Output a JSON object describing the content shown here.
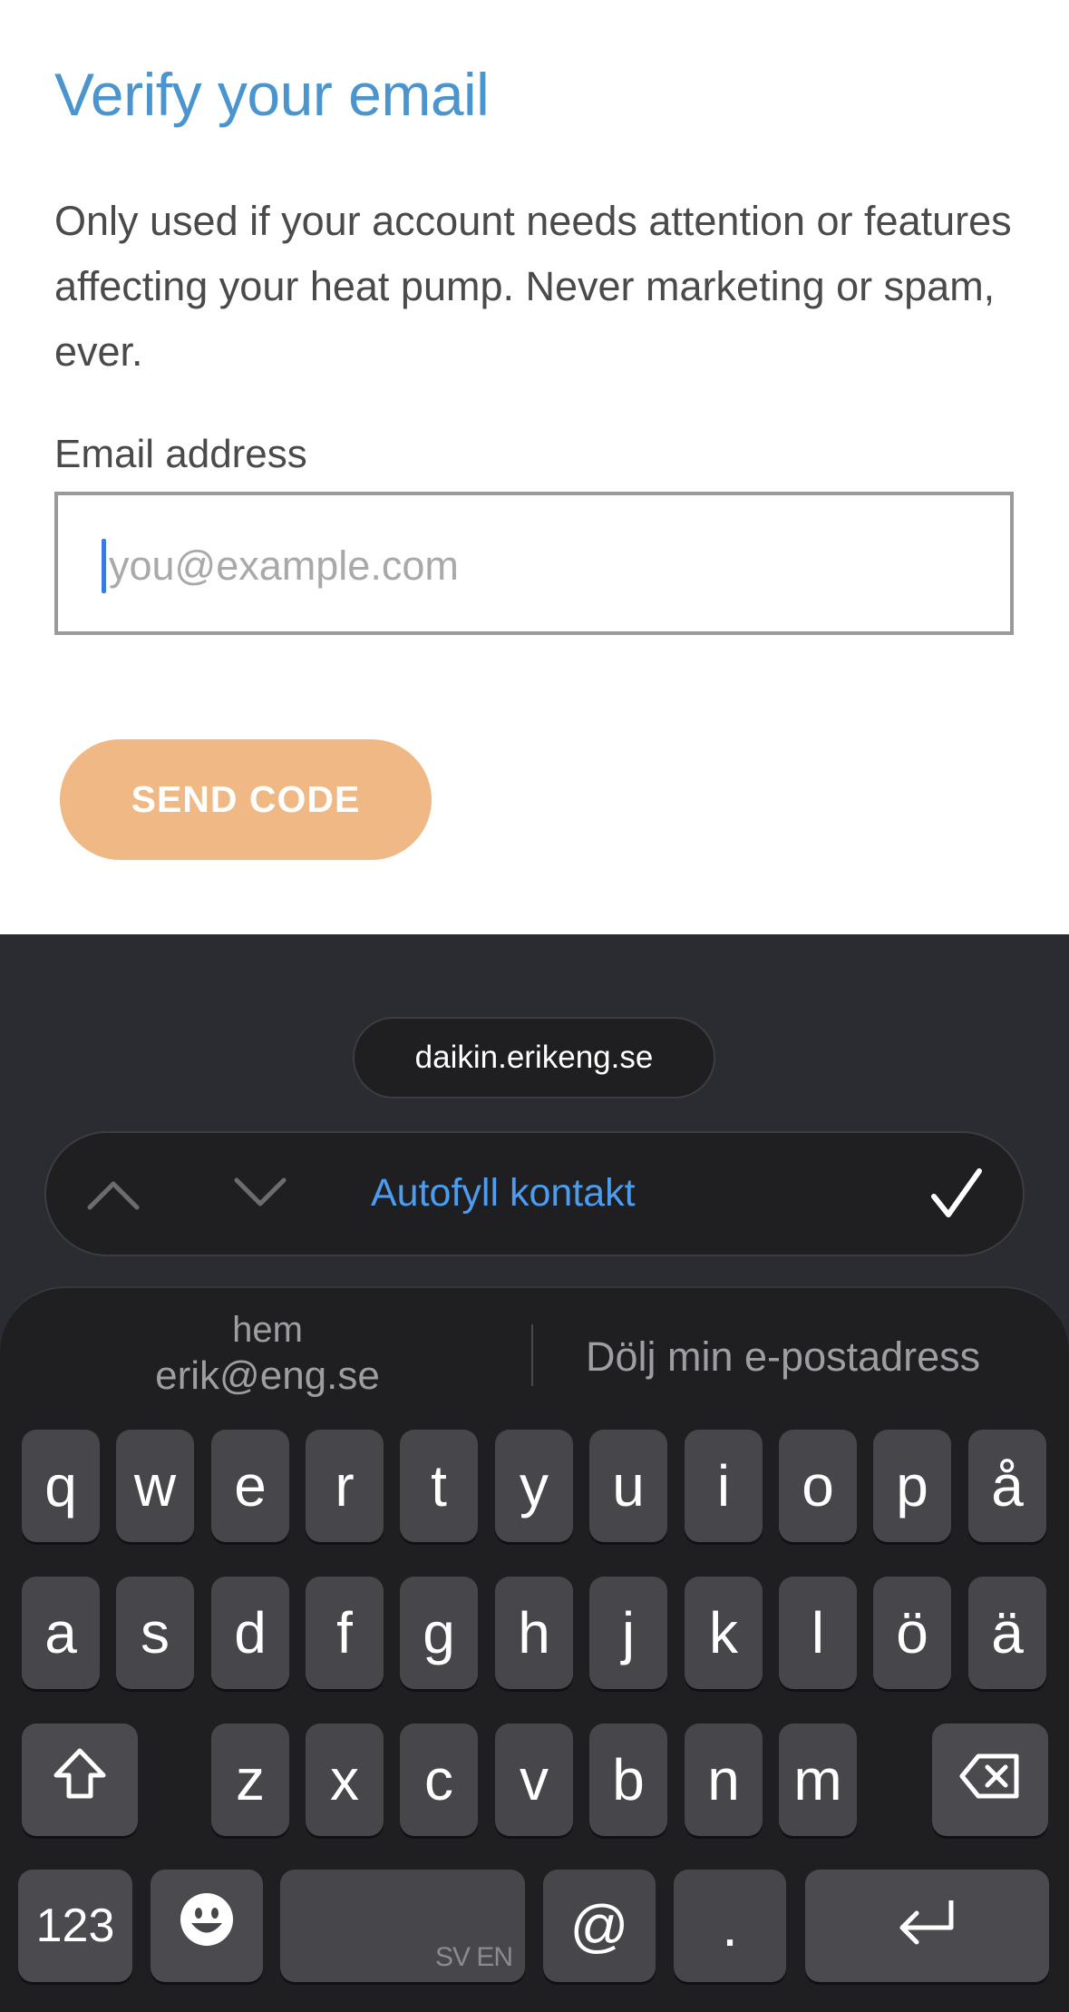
{
  "page": {
    "title": "Verify your email",
    "description": "Only used if your account needs attention or features affecting your heat pump. Never marketing or spam, ever.",
    "email_label": "Email address",
    "email_value": "",
    "email_placeholder": "you@example.com",
    "send_button_label": "SEND CODE"
  },
  "colors": {
    "title": "#4b95cf",
    "button": "#efb884",
    "autofill": "#4c9cf0",
    "keyboard_bg": "#2b2c31",
    "key_bg": "#46464b"
  },
  "keyboard": {
    "domain": "daikin.erikeng.se",
    "autofill_label": "Autofyll kontakt",
    "icons": [
      "chevron-up-icon",
      "chevron-down-icon",
      "checkmark-icon",
      "shift-icon",
      "backspace-icon",
      "emoji-icon",
      "return-icon"
    ],
    "suggestion_left": {
      "line1": "hem",
      "line2": "erik@eng.se"
    },
    "suggestion_right": "Dölj min e-postadress",
    "row1": [
      "q",
      "w",
      "e",
      "r",
      "t",
      "y",
      "u",
      "i",
      "o",
      "p",
      "å"
    ],
    "row2": [
      "a",
      "s",
      "d",
      "f",
      "g",
      "h",
      "j",
      "k",
      "l",
      "ö",
      "ä"
    ],
    "row3": [
      "z",
      "x",
      "c",
      "v",
      "b",
      "n",
      "m"
    ],
    "numbers_label": "123",
    "space_lang": "SV EN",
    "at": "@",
    "dot": "."
  }
}
